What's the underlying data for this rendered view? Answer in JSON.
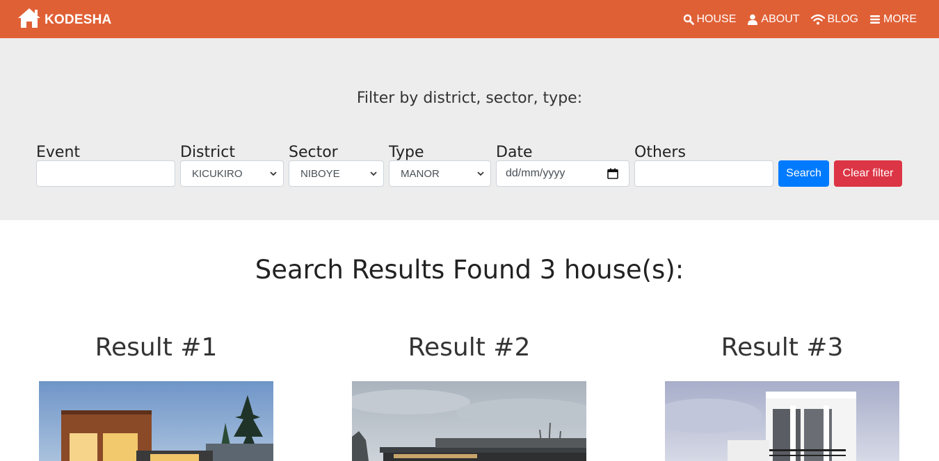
{
  "navbar": {
    "brand": "KODESHA",
    "items": [
      {
        "label": "HOUSE",
        "icon": "search-icon"
      },
      {
        "label": "ABOUT",
        "icon": "user-icon"
      },
      {
        "label": "BLOG",
        "icon": "wifi-icon"
      },
      {
        "label": "MORE",
        "icon": "menu-icon"
      }
    ]
  },
  "filter": {
    "title": "Filter by district, sector, type:",
    "event": {
      "label": "Event",
      "value": ""
    },
    "district": {
      "label": "District",
      "value": "KICUKIRO"
    },
    "sector": {
      "label": "Sector",
      "value": "NIBOYE"
    },
    "type": {
      "label": "Type",
      "value": "MANOR"
    },
    "date": {
      "label": "Date",
      "placeholder": "dd/mm/yyyy"
    },
    "others": {
      "label": "Others",
      "value": ""
    },
    "search_label": "Search",
    "clear_label": "Clear filter"
  },
  "results": {
    "heading": "Search Results Found 3 house(s):",
    "items": [
      {
        "title": "Result #1"
      },
      {
        "title": "Result #2"
      },
      {
        "title": "Result #3"
      }
    ]
  },
  "colors": {
    "navbar": "#e06036",
    "filter_bg": "#ededed",
    "primary": "#007bff",
    "danger": "#dc3545"
  }
}
